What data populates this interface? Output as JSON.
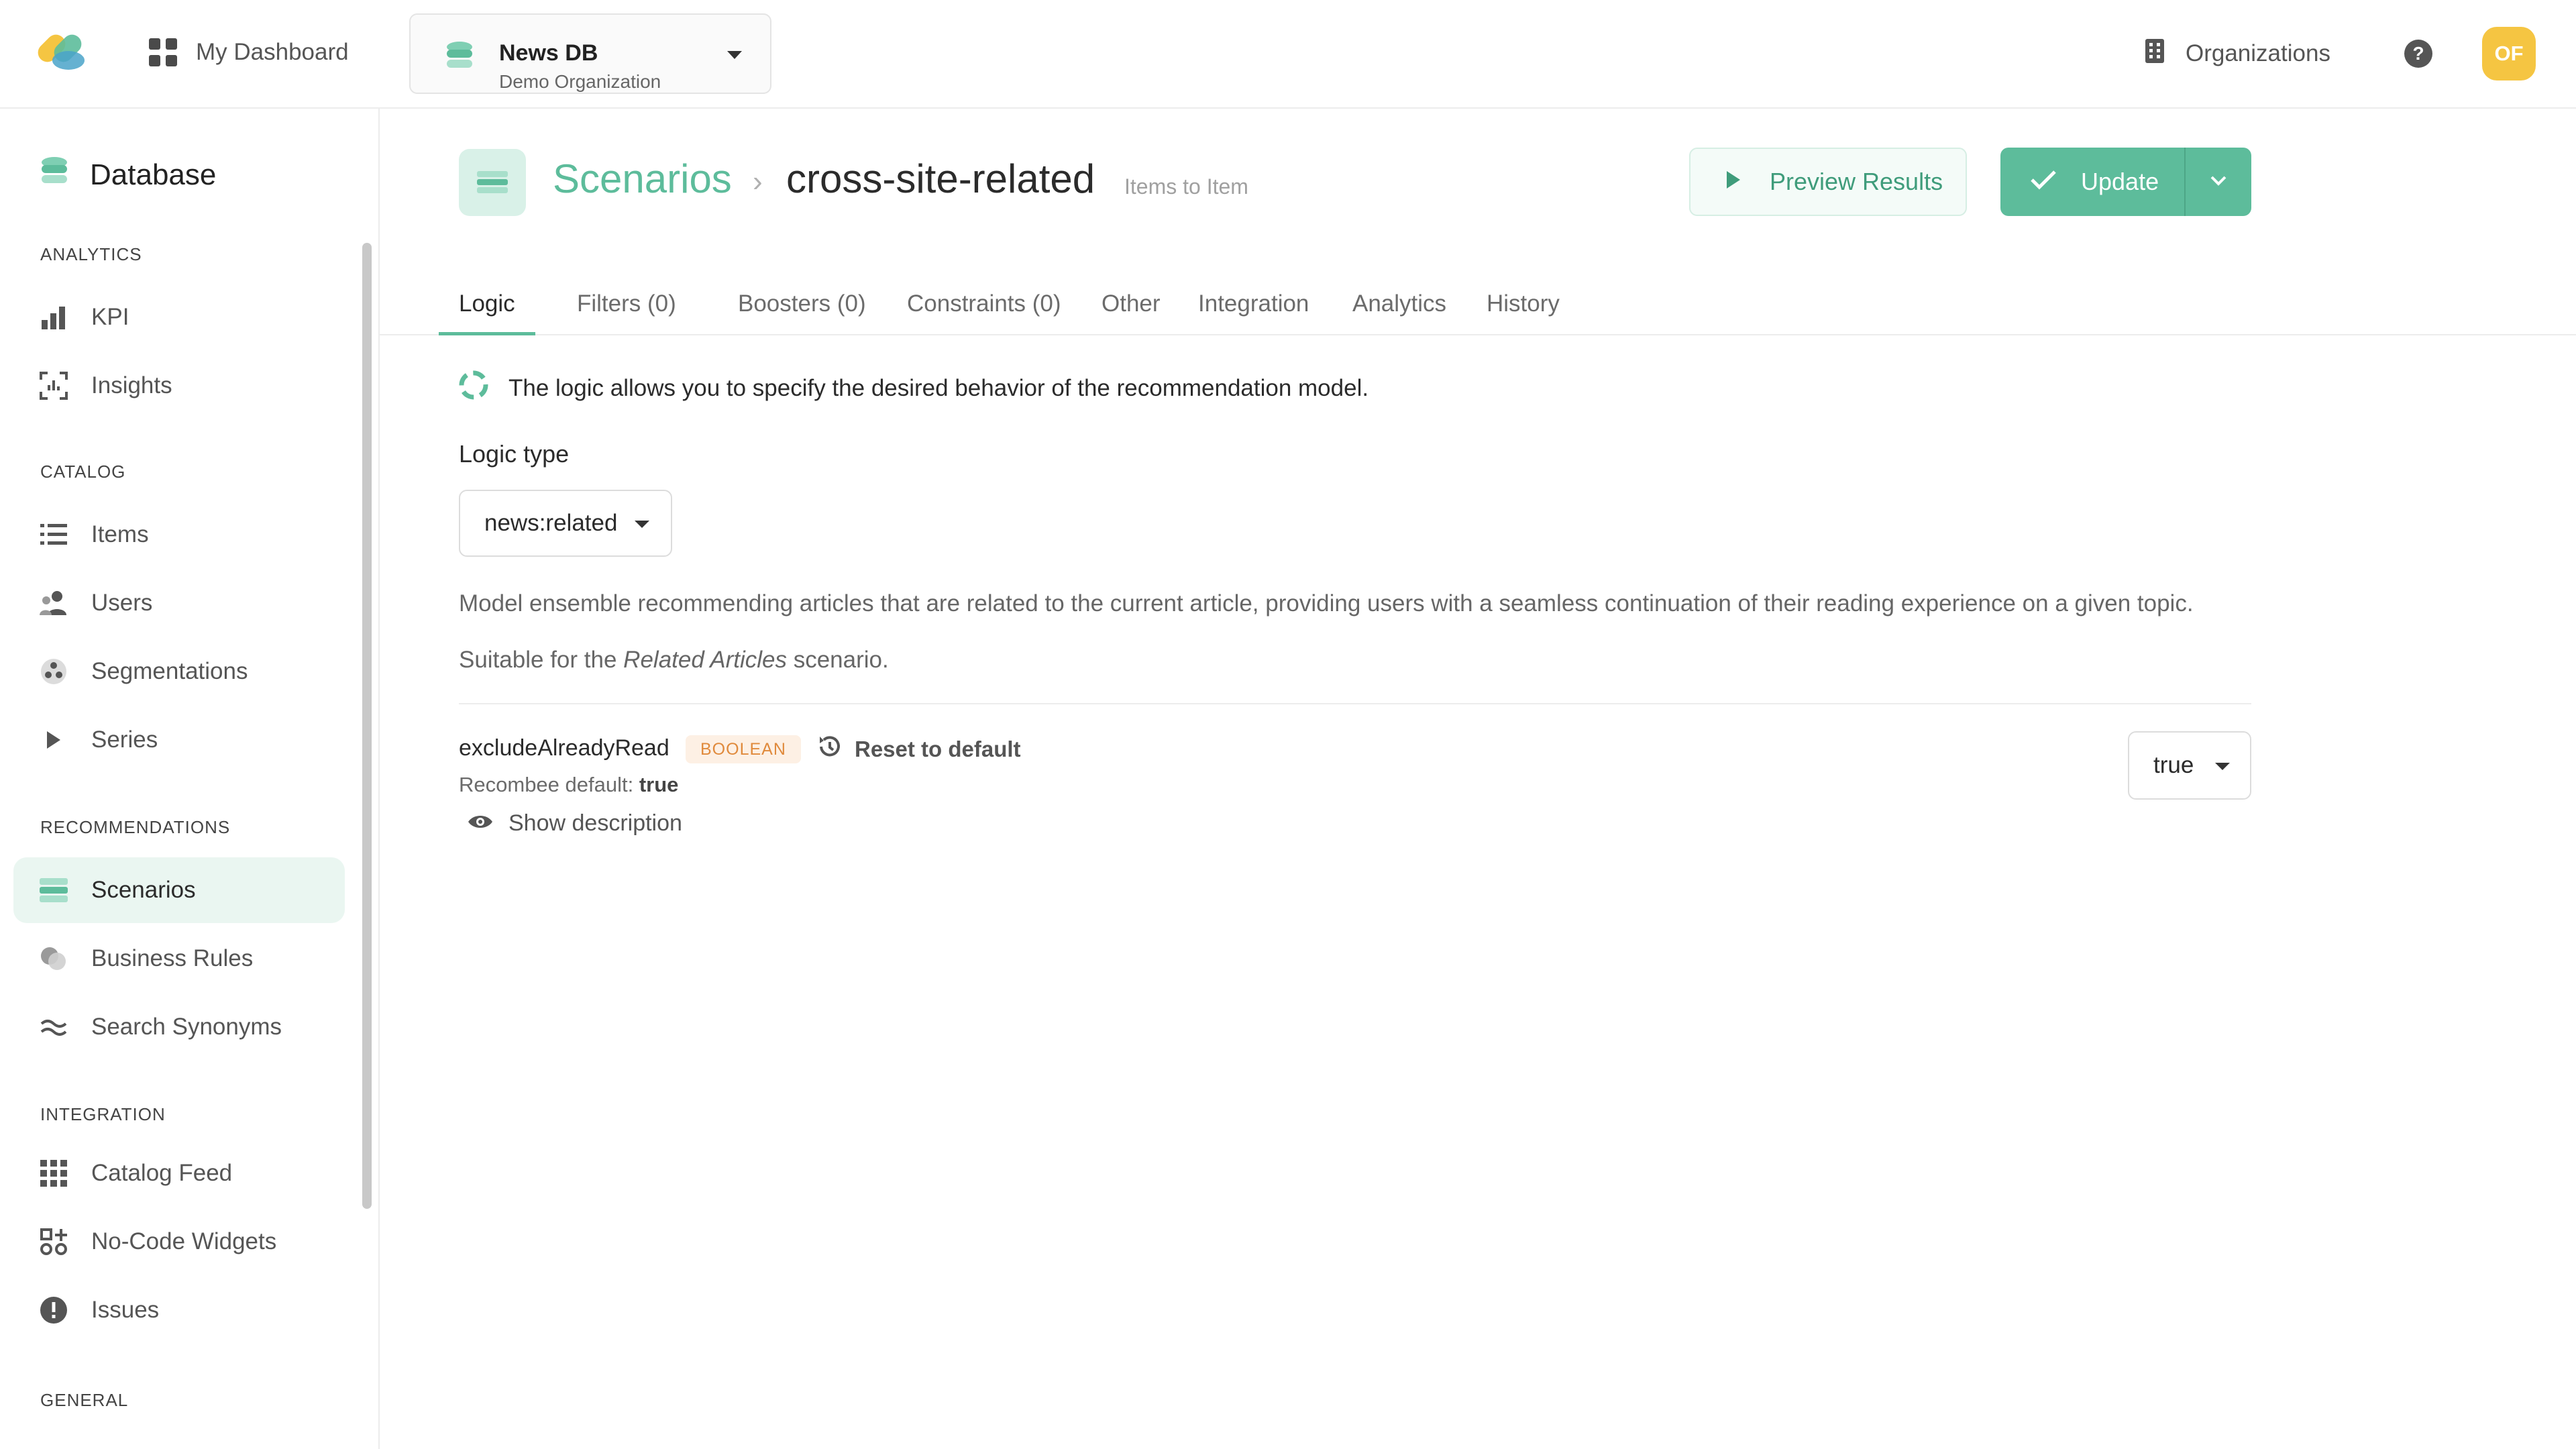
{
  "header": {
    "dashboard_label": "My Dashboard",
    "database": {
      "name": "News DB",
      "organization": "Demo Organization"
    },
    "organizations_label": "Organizations",
    "help_label": "?",
    "avatar_initials": "OF"
  },
  "sidebar": {
    "title": "Database",
    "sections": {
      "analytics": "ANALYTICS",
      "catalog": "CATALOG",
      "recommendations": "RECOMMENDATIONS",
      "integration": "INTEGRATION",
      "general": "GENERAL"
    },
    "items": {
      "kpi": "KPI",
      "insights": "Insights",
      "items": "Items",
      "users": "Users",
      "segmentations": "Segmentations",
      "series": "Series",
      "scenarios": "Scenarios",
      "business_rules": "Business Rules",
      "search_synonyms": "Search Synonyms",
      "catalog_feed": "Catalog Feed",
      "no_code_widgets": "No-Code Widgets",
      "issues": "Issues"
    },
    "active_item": "Scenarios"
  },
  "page": {
    "breadcrumb_root": "Scenarios",
    "breadcrumb_separator": "›",
    "scenario_name": "cross-site-related",
    "scenario_type": "Items to Item",
    "preview_label": "Preview Results",
    "update_label": "Update"
  },
  "tabs": [
    "Logic",
    "Filters (0)",
    "Boosters (0)",
    "Constraints (0)",
    "Other",
    "Integration",
    "Analytics",
    "History"
  ],
  "active_tab": "Logic",
  "logic": {
    "info_text": "The logic allows you to specify the desired behavior of the recommendation model.",
    "type_label": "Logic type",
    "type_value": "news:related",
    "description": "Model ensemble recommending articles that are related to the current article, providing users with a seamless continuation of their reading experience on a given topic.",
    "suitable_prefix": "Suitable for the",
    "suitable_scenario": "Related Articles",
    "suitable_suffix": "scenario."
  },
  "parameter": {
    "name": "excludeAlreadyRead",
    "type_badge": "BOOLEAN",
    "reset_label": "Reset to default",
    "default_label": "Recombee default:",
    "default_value": "true",
    "show_description_label": "Show description",
    "value": "true"
  },
  "colors": {
    "accent": "#5dbc9b",
    "accent_light": "#eaf6f1",
    "badge_text": "#e08a3c",
    "badge_bg": "#fdf0e4",
    "avatar": "#f5c542"
  }
}
